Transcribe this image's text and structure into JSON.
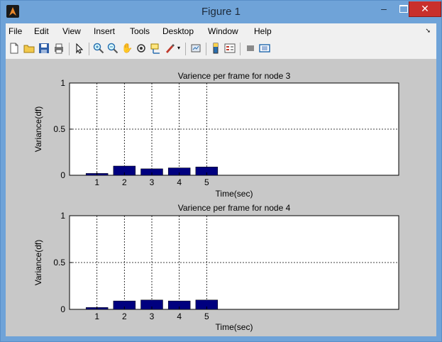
{
  "window": {
    "title": "Figure 1"
  },
  "menu": [
    "File",
    "Edit",
    "View",
    "Insert",
    "Tools",
    "Desktop",
    "Window",
    "Help"
  ],
  "toolbar_icons": [
    "new-figure-icon",
    "open-file-icon",
    "save-icon",
    "print-icon",
    "pointer-icon",
    "zoom-in-icon",
    "zoom-out-icon",
    "pan-icon",
    "rotate-3d-icon",
    "data-cursor-icon",
    "brush-icon",
    "brush-dropdown-icon",
    "link-plot-icon",
    "colorbar-icon",
    "legend-icon",
    "hide-plot-tools-icon",
    "show-plot-tools-icon"
  ],
  "colors": {
    "bar": "#00007f",
    "figure_bg": "#c8c8c8",
    "titlebar": "#6fa3d8",
    "close": "#c9302c"
  },
  "chart_data": [
    {
      "type": "bar",
      "title": "Varience per frame for node 3",
      "xlabel": "Time(sec)",
      "ylabel": "Variance(df)",
      "categories": [
        "1",
        "2",
        "3",
        "4",
        "5"
      ],
      "values": [
        0.02,
        0.1,
        0.07,
        0.08,
        0.09
      ],
      "xlim": [
        0,
        12
      ],
      "ylim": [
        0,
        1
      ],
      "yticks": [
        "0",
        "0.5",
        "1"
      ],
      "grid": true
    },
    {
      "type": "bar",
      "title": "Varience per frame for node 4",
      "xlabel": "Time(sec)",
      "ylabel": "Variance(df)",
      "categories": [
        "1",
        "2",
        "3",
        "4",
        "5"
      ],
      "values": [
        0.02,
        0.09,
        0.1,
        0.09,
        0.1
      ],
      "xlim": [
        0,
        12
      ],
      "ylim": [
        0,
        1
      ],
      "yticks": [
        "0",
        "0.5",
        "1"
      ],
      "grid": true
    }
  ]
}
